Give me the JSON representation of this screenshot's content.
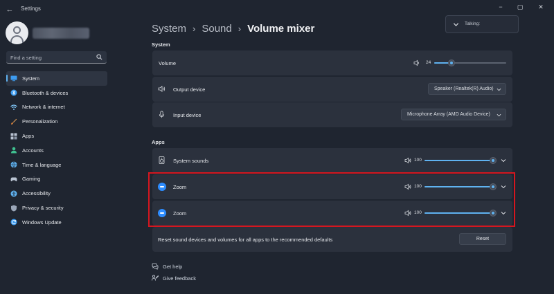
{
  "window": {
    "title": "Settings",
    "controls": {
      "minimize": "−",
      "maximize": "▢",
      "close": "✕"
    }
  },
  "search": {
    "placeholder": "Find a setting"
  },
  "sidebar": {
    "items": [
      {
        "label": "System",
        "icon": "system-icon",
        "color": "#3d9cf0",
        "selected": true
      },
      {
        "label": "Bluetooth & devices",
        "icon": "bluetooth-icon",
        "color": "#3d9cf0"
      },
      {
        "label": "Network & internet",
        "icon": "wifi-icon",
        "color": "#7fc4f5"
      },
      {
        "label": "Personalization",
        "icon": "brush-icon",
        "color": "#e8a35a"
      },
      {
        "label": "Apps",
        "icon": "apps-icon",
        "color": "#b9c3d2"
      },
      {
        "label": "Accounts",
        "icon": "person-icon",
        "color": "#3fbf8f"
      },
      {
        "label": "Time & language",
        "icon": "globe-clock-icon",
        "color": "#5fb2f0"
      },
      {
        "label": "Gaming",
        "icon": "gamepad-icon",
        "color": "#b9c3d2"
      },
      {
        "label": "Accessibility",
        "icon": "accessibility-icon",
        "color": "#5fb2f0"
      },
      {
        "label": "Privacy & security",
        "icon": "shield-icon",
        "color": "#9aa6b8"
      },
      {
        "label": "Windows Update",
        "icon": "refresh-icon",
        "color": "#3d9cf0"
      }
    ]
  },
  "breadcrumb": [
    "System",
    "Sound",
    "Volume mixer"
  ],
  "talking": {
    "label": "Talking:"
  },
  "system_section": {
    "heading": "System",
    "volume": {
      "label": "Volume",
      "value": "24",
      "level": 24
    },
    "output": {
      "label": "Output device",
      "selected": "Speaker (Realtek(R) Audio)"
    },
    "input": {
      "label": "Input device",
      "selected": "Microphone Array (AMD Audio Device)"
    }
  },
  "apps_section": {
    "heading": "Apps",
    "apps": [
      {
        "name": "System sounds",
        "volume": "100",
        "level": 100
      },
      {
        "name": "Zoom",
        "volume": "100",
        "level": 100
      },
      {
        "name": "Zoom",
        "volume": "100",
        "level": 100
      }
    ]
  },
  "reset": {
    "label": "Reset sound devices and volumes for all apps to the recommended defaults",
    "button": "Reset"
  },
  "help": {
    "get_help": "Get help",
    "give_feedback": "Give feedback"
  },
  "colors": {
    "accent": "#5fb2f0",
    "highlight_box": "#d6161f",
    "zoom_brand": "#2d8cff"
  }
}
